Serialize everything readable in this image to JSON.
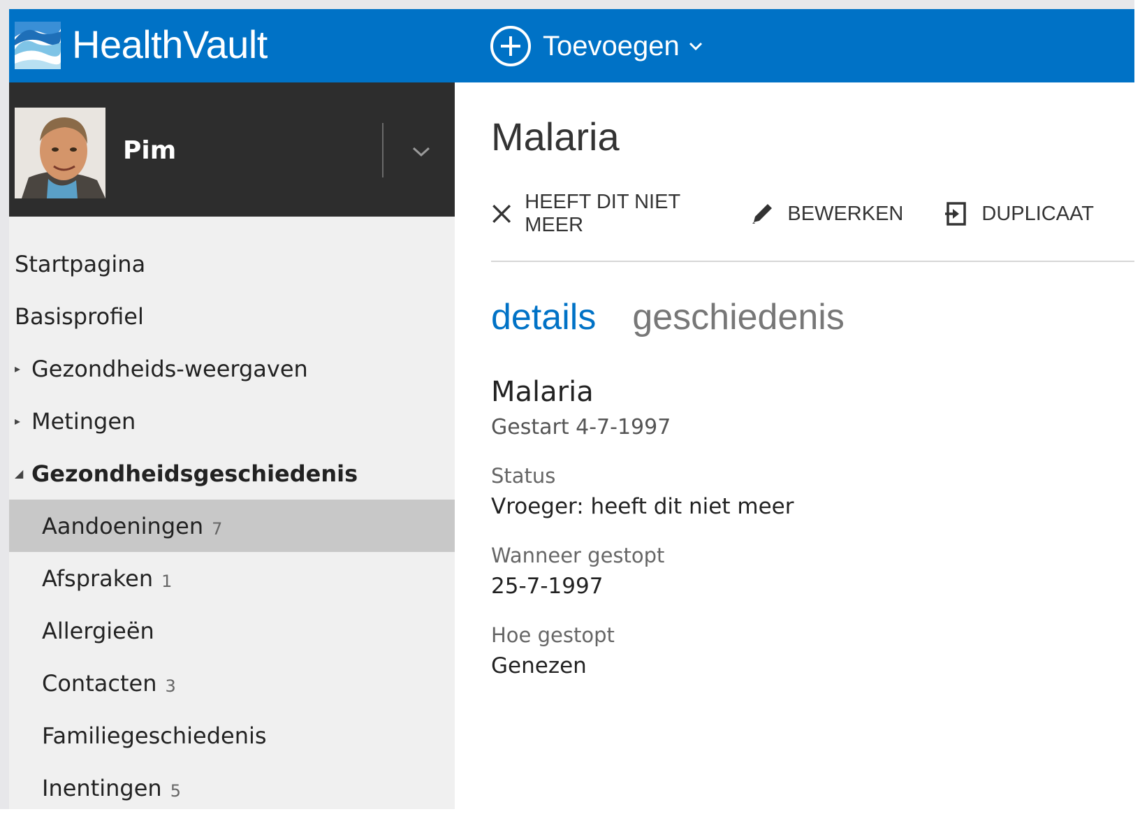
{
  "app": {
    "brand": "HealthVault"
  },
  "header": {
    "add_label": "Toevoegen",
    "add_icon": "plus-circle-icon",
    "accent_color": "#0072c6"
  },
  "profile": {
    "name": "Pim"
  },
  "sidebar": {
    "items": [
      {
        "label": "Startpagina"
      },
      {
        "label": "Basisprofiel"
      },
      {
        "label": "Gezondheids-weergaven"
      },
      {
        "label": "Metingen"
      },
      {
        "label": "Gezondheidsgeschiedenis"
      },
      {
        "label": "Aandoeningen",
        "count": "7"
      },
      {
        "label": "Afspraken",
        "count": "1"
      },
      {
        "label": "Allergieën"
      },
      {
        "label": "Contacten",
        "count": "3"
      },
      {
        "label": "Familiegeschiedenis"
      },
      {
        "label": "Inentingen",
        "count": "5"
      }
    ]
  },
  "main": {
    "title": "Malaria",
    "actions": {
      "remove": "HEEFT DIT NIET MEER",
      "edit": "BEWERKEN",
      "duplicate": "DUPLICAAT"
    },
    "tabs": {
      "details": "details",
      "history": "geschiedenis"
    },
    "detail": {
      "name": "Malaria",
      "started": "Gestart 4-7-1997",
      "status_label": "Status",
      "status_value": "Vroeger: heeft dit niet meer",
      "stopped_label": "Wanneer gestopt",
      "stopped_value": "25-7-1997",
      "how_label": "Hoe gestopt",
      "how_value": "Genezen"
    }
  }
}
